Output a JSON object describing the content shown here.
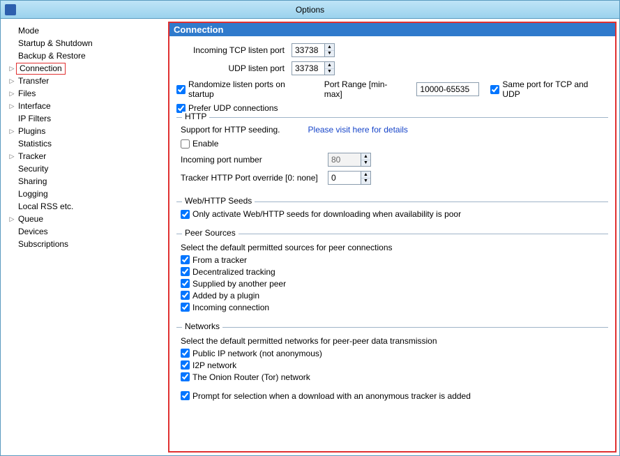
{
  "window": {
    "title": "Options"
  },
  "sidebar": {
    "items": [
      {
        "label": "Mode",
        "expander": "",
        "highlight": false
      },
      {
        "label": "Startup & Shutdown",
        "expander": "",
        "highlight": false
      },
      {
        "label": "Backup & Restore",
        "expander": "",
        "highlight": false
      },
      {
        "label": "Connection",
        "expander": "▷",
        "highlight": true
      },
      {
        "label": "Transfer",
        "expander": "▷",
        "highlight": false
      },
      {
        "label": "Files",
        "expander": "▷",
        "highlight": false
      },
      {
        "label": "Interface",
        "expander": "▷",
        "highlight": false
      },
      {
        "label": "IP Filters",
        "expander": "",
        "highlight": false
      },
      {
        "label": "Plugins",
        "expander": "▷",
        "highlight": false
      },
      {
        "label": "Statistics",
        "expander": "",
        "highlight": false
      },
      {
        "label": "Tracker",
        "expander": "▷",
        "highlight": false
      },
      {
        "label": "Security",
        "expander": "",
        "highlight": false
      },
      {
        "label": "Sharing",
        "expander": "",
        "highlight": false
      },
      {
        "label": "Logging",
        "expander": "",
        "highlight": false
      },
      {
        "label": "Local RSS etc.",
        "expander": "",
        "highlight": false
      },
      {
        "label": "Queue",
        "expander": "▷",
        "highlight": false
      },
      {
        "label": "Devices",
        "expander": "",
        "highlight": false
      },
      {
        "label": "Subscriptions",
        "expander": "",
        "highlight": false
      }
    ]
  },
  "panel": {
    "title": "Connection",
    "tcp_label": "Incoming TCP listen port",
    "tcp_value": "33738",
    "udp_label": "UDP listen port",
    "udp_value": "33738",
    "randomize_label": "Randomize listen ports on startup",
    "port_range_label": "Port Range [min-max]",
    "port_range_value": "10000-65535",
    "same_port_label": "Same port for TCP and UDP",
    "prefer_udp_label": "Prefer UDP connections",
    "http": {
      "legend": "HTTP",
      "support_text": "Support for HTTP seeding.",
      "details_link": "Please visit here for details",
      "enable_label": "Enable",
      "incoming_port_label": "Incoming port number",
      "incoming_port_value": "80",
      "override_label": "Tracker HTTP Port override [0: none]",
      "override_value": "0"
    },
    "webseeds": {
      "legend": "Web/HTTP Seeds",
      "only_activate_label": "Only activate Web/HTTP seeds for downloading when availability is poor"
    },
    "peers": {
      "legend": "Peer Sources",
      "desc": "Select the default permitted sources for peer connections",
      "opts": [
        "From a tracker",
        "Decentralized tracking",
        "Supplied by another peer",
        "Added by a plugin",
        "Incoming connection"
      ]
    },
    "networks": {
      "legend": "Networks",
      "desc": "Select the default permitted networks for peer-peer data transmission",
      "opts": [
        "Public IP network (not anonymous)",
        "I2P network",
        "The Onion Router (Tor) network"
      ],
      "prompt_label": "Prompt for selection when a download with an anonymous tracker is added"
    }
  }
}
